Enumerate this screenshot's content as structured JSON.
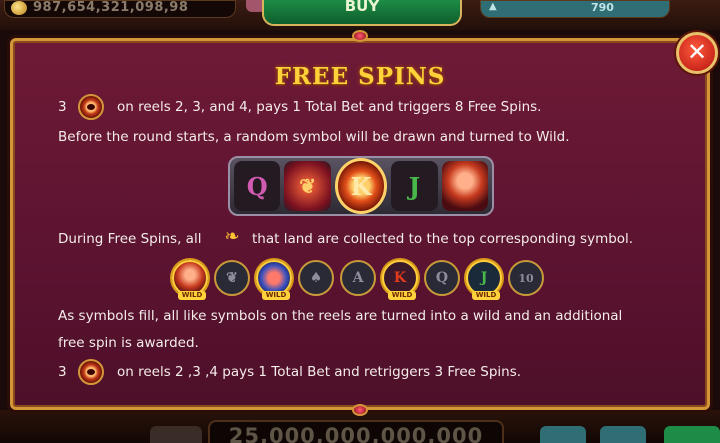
{
  "colors": {
    "panel_bg": "#5b1330",
    "frame_gold": "#d5963a",
    "title_yellow": "#ffd23b",
    "close_red": "#d2201a",
    "buy_green": "#1d8c46"
  },
  "topbar": {
    "balance": "987,654,321,098,98",
    "buy_label": "BUY",
    "level_number": "790"
  },
  "bottombar": {
    "bet_value": "25,000,000,000,000"
  },
  "dialog": {
    "title": "FREE SPINS",
    "close_icon": "close-icon",
    "line1": {
      "count": "3",
      "icon": "scatter-icon",
      "text": "on reels 2, 3, and 4, pays 1 Total Bet and triggers 8 Free Spins."
    },
    "line2": "Before the round starts, a random symbol will be drawn and turned to Wild.",
    "reel_example": [
      {
        "symbol": "Q",
        "color": "#d05bb0"
      },
      {
        "symbol": "phoenix",
        "color": "#ff6b3a"
      },
      {
        "symbol": "K",
        "color": "#e53a1c"
      },
      {
        "symbol": "J",
        "color": "#49b84a"
      },
      {
        "symbol": "woman",
        "color": "#c63a1e"
      }
    ],
    "line3": {
      "before": "During Free Spins, all",
      "icon": "feather-icon",
      "after": "that land are collected to the top corresponding symbol."
    },
    "collectors": [
      {
        "symbol": "woman",
        "wild": "WILD"
      },
      {
        "symbol": "phoenix",
        "wild": ""
      },
      {
        "symbol": "egg",
        "wild": "WILD"
      },
      {
        "symbol": "spade",
        "wild": ""
      },
      {
        "symbol": "A",
        "wild": ""
      },
      {
        "symbol": "K",
        "wild": "WILD"
      },
      {
        "symbol": "Q",
        "wild": ""
      },
      {
        "symbol": "J",
        "wild": "WILD"
      },
      {
        "symbol": "10",
        "wild": ""
      }
    ],
    "line4": "As symbols fill, all like symbols on the reels are turned into a wild  and an additional",
    "line5": "free spin is awarded.",
    "line6": {
      "count": "3",
      "icon": "scatter-icon",
      "text": "on reels 2 ,3 ,4 pays 1 Total Bet and retriggers 3 Free Spins."
    }
  }
}
